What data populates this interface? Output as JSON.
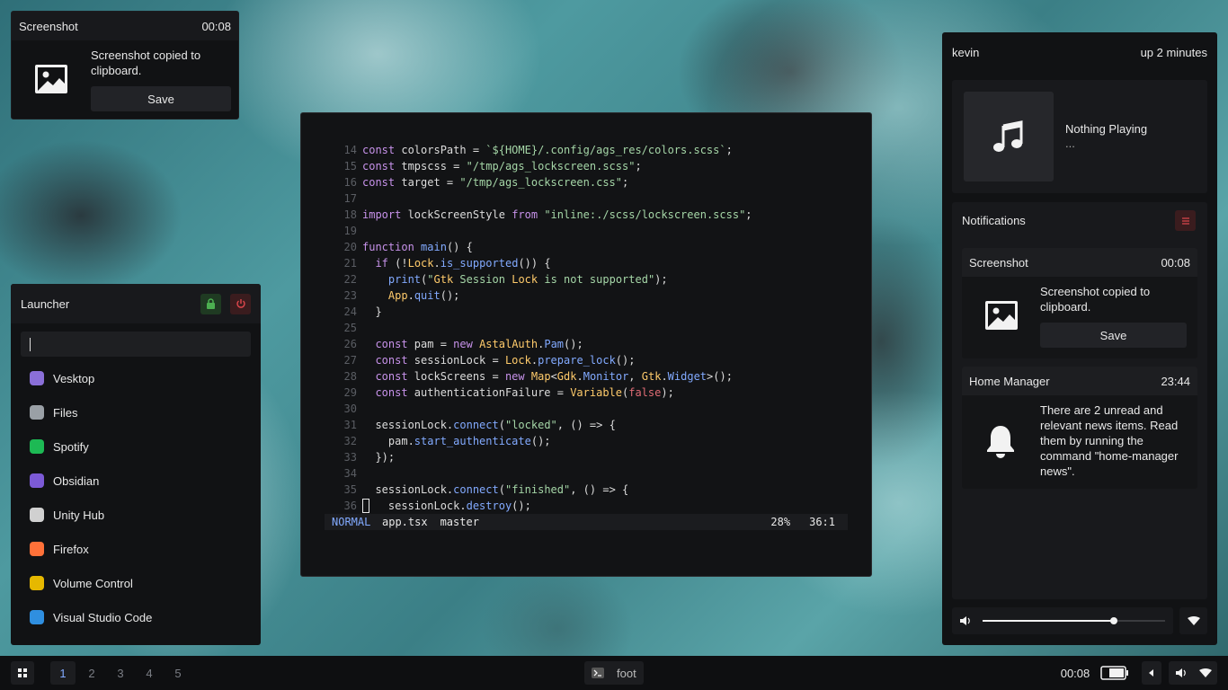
{
  "toast": {
    "title": "Screenshot",
    "time": "00:08",
    "message": "Screenshot copied to clipboard.",
    "save_label": "Save"
  },
  "launcher": {
    "title": "Launcher",
    "search_value": "",
    "apps": [
      {
        "label": "Vesktop",
        "color": "#8a6fd8"
      },
      {
        "label": "Files",
        "color": "#9aa0a6"
      },
      {
        "label": "Spotify",
        "color": "#1db954"
      },
      {
        "label": "Obsidian",
        "color": "#7c5ad6"
      },
      {
        "label": "Unity Hub",
        "color": "#d0d0d0"
      },
      {
        "label": "Firefox",
        "color": "#ff7139"
      },
      {
        "label": "Volume Control",
        "color": "#e6b800"
      },
      {
        "label": "Visual Studio Code",
        "color": "#2f8fe0"
      }
    ]
  },
  "editor": {
    "lines": [
      {
        "n": "14",
        "t": "const colorsPath = `${HOME}/.config/ags_res/colors.scss`;"
      },
      {
        "n": "15",
        "t": "const tmpscss = \"/tmp/ags_lockscreen.scss\";"
      },
      {
        "n": "16",
        "t": "const target = \"/tmp/ags_lockscreen.css\";"
      },
      {
        "n": "17",
        "t": ""
      },
      {
        "n": "18",
        "t": "import lockScreenStyle from \"inline:./scss/lockscreen.scss\";"
      },
      {
        "n": "19",
        "t": ""
      },
      {
        "n": "20",
        "t": "function main() {"
      },
      {
        "n": "21",
        "t": "  if (!Lock.is_supported()) {"
      },
      {
        "n": "22",
        "t": "    print(\"Gtk Session Lock is not supported\");"
      },
      {
        "n": "23",
        "t": "    App.quit();"
      },
      {
        "n": "24",
        "t": "  }"
      },
      {
        "n": "25",
        "t": ""
      },
      {
        "n": "26",
        "t": "  const pam = new AstalAuth.Pam();"
      },
      {
        "n": "27",
        "t": "  const sessionLock = Lock.prepare_lock();"
      },
      {
        "n": "28",
        "t": "  const lockScreens = new Map<Gdk.Monitor, Gtk.Widget>();"
      },
      {
        "n": "29",
        "t": "  const authenticationFailure = Variable(false);"
      },
      {
        "n": "30",
        "t": ""
      },
      {
        "n": "31",
        "t": "  sessionLock.connect(\"locked\", () => {"
      },
      {
        "n": "32",
        "t": "    pam.start_authenticate();"
      },
      {
        "n": "33",
        "t": "  });"
      },
      {
        "n": "34",
        "t": ""
      },
      {
        "n": "35",
        "t": "  sessionLock.connect(\"finished\", () => {"
      },
      {
        "n": "36",
        "t": "    sessionLock.destroy();"
      }
    ],
    "status": {
      "mode": "NORMAL",
      "file": "app.tsx",
      "branch": "master",
      "percent": "28%",
      "position": "36:1"
    }
  },
  "right_panel": {
    "user": "kevin",
    "uptime": "up 2 minutes",
    "media": {
      "title": "Nothing Playing",
      "subtitle": "..."
    },
    "notifications_title": "Notifications",
    "notifications": [
      {
        "app": "Screenshot",
        "time": "00:08",
        "body": "Screenshot copied to clipboard.",
        "action": "Save"
      },
      {
        "app": "Home Manager",
        "time": "23:44",
        "body": "There are 2 unread and relevant news items. Read them by running the command \"home-manager news\"."
      }
    ],
    "volume_level": 0.72
  },
  "taskbar": {
    "workspaces": [
      "1",
      "2",
      "3",
      "4",
      "5"
    ],
    "active_workspace": "1",
    "window_title": "foot",
    "clock": "00:08"
  },
  "colors": {
    "accent_red": "#e0474c",
    "accent_green": "#4caf50",
    "panel": "#111214"
  }
}
